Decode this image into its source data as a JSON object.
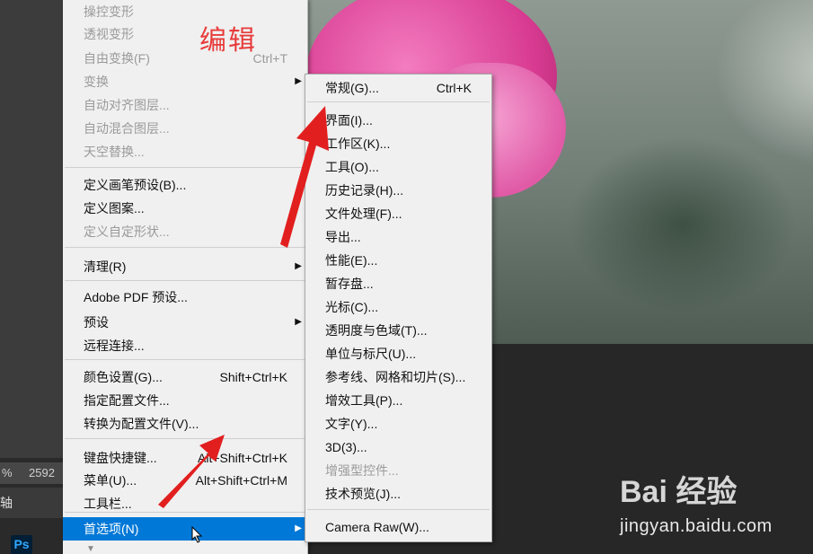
{
  "background": {
    "status": {
      "zoom": "%",
      "size": "2592"
    },
    "panel_tab": "轴",
    "app_logo": "Ps"
  },
  "annotation": {
    "text": "编辑"
  },
  "edit_menu": {
    "items": [
      {
        "label": "操控变形",
        "shortcut": "",
        "disabled": true,
        "submenu": false
      },
      {
        "label": "透视变形",
        "shortcut": "",
        "disabled": true,
        "submenu": false
      },
      {
        "label": "自由变换(F)",
        "shortcut": "Ctrl+T",
        "disabled": true,
        "submenu": false
      },
      {
        "label": "变换",
        "shortcut": "",
        "disabled": true,
        "submenu": true
      },
      {
        "label": "自动对齐图层...",
        "shortcut": "",
        "disabled": true,
        "submenu": false
      },
      {
        "label": "自动混合图层...",
        "shortcut": "",
        "disabled": true,
        "submenu": false
      },
      {
        "label": "天空替换...",
        "shortcut": "",
        "disabled": true,
        "submenu": false
      },
      {
        "label": "定义画笔预设(B)...",
        "shortcut": "",
        "disabled": false,
        "submenu": false
      },
      {
        "label": "定义图案...",
        "shortcut": "",
        "disabled": false,
        "submenu": false
      },
      {
        "label": "定义自定形状...",
        "shortcut": "",
        "disabled": true,
        "submenu": false
      },
      {
        "label": "清理(R)",
        "shortcut": "",
        "disabled": false,
        "submenu": true
      },
      {
        "label": "Adobe PDF 预设...",
        "shortcut": "",
        "disabled": false,
        "submenu": false
      },
      {
        "label": "预设",
        "shortcut": "",
        "disabled": false,
        "submenu": true
      },
      {
        "label": "远程连接...",
        "shortcut": "",
        "disabled": false,
        "submenu": false
      },
      {
        "label": "颜色设置(G)...",
        "shortcut": "Shift+Ctrl+K",
        "disabled": false,
        "submenu": false
      },
      {
        "label": "指定配置文件...",
        "shortcut": "",
        "disabled": false,
        "submenu": false
      },
      {
        "label": "转换为配置文件(V)...",
        "shortcut": "",
        "disabled": false,
        "submenu": false
      },
      {
        "label": "键盘快捷键...",
        "shortcut": "Alt+Shift+Ctrl+K",
        "disabled": false,
        "submenu": false
      },
      {
        "label": "菜单(U)...",
        "shortcut": "Alt+Shift+Ctrl+M",
        "disabled": false,
        "submenu": false
      },
      {
        "label": "工具栏...",
        "shortcut": "",
        "disabled": false,
        "submenu": false
      },
      {
        "label": "首选项(N)",
        "shortcut": "",
        "disabled": false,
        "submenu": true,
        "selected": true
      }
    ]
  },
  "preferences_submenu": {
    "items": [
      {
        "label": "常规(G)...",
        "shortcut": "Ctrl+K",
        "disabled": false
      },
      {
        "label": "界面(I)...",
        "shortcut": "",
        "disabled": false
      },
      {
        "label": "工作区(K)...",
        "shortcut": "",
        "disabled": false
      },
      {
        "label": "工具(O)...",
        "shortcut": "",
        "disabled": false
      },
      {
        "label": "历史记录(H)...",
        "shortcut": "",
        "disabled": false
      },
      {
        "label": "文件处理(F)...",
        "shortcut": "",
        "disabled": false
      },
      {
        "label": "导出...",
        "shortcut": "",
        "disabled": false
      },
      {
        "label": "性能(E)...",
        "shortcut": "",
        "disabled": false
      },
      {
        "label": "暂存盘...",
        "shortcut": "",
        "disabled": false
      },
      {
        "label": "光标(C)...",
        "shortcut": "",
        "disabled": false
      },
      {
        "label": "透明度与色域(T)...",
        "shortcut": "",
        "disabled": false
      },
      {
        "label": "单位与标尺(U)...",
        "shortcut": "",
        "disabled": false
      },
      {
        "label": "参考线、网格和切片(S)...",
        "shortcut": "",
        "disabled": false
      },
      {
        "label": "增效工具(P)...",
        "shortcut": "",
        "disabled": false
      },
      {
        "label": "文字(Y)...",
        "shortcut": "",
        "disabled": false
      },
      {
        "label": "3D(3)...",
        "shortcut": "",
        "disabled": false
      },
      {
        "label": "增强型控件...",
        "shortcut": "",
        "disabled": true
      },
      {
        "label": "技术预览(J)...",
        "shortcut": "",
        "disabled": false
      },
      {
        "label": "Camera Raw(W)...",
        "shortcut": "",
        "disabled": false
      }
    ]
  },
  "watermark": {
    "brand": "Bai 经验",
    "url": "jingyan.baidu.com"
  },
  "colors": {
    "selection": "#0078d7",
    "annotation": "#e83b3b"
  }
}
